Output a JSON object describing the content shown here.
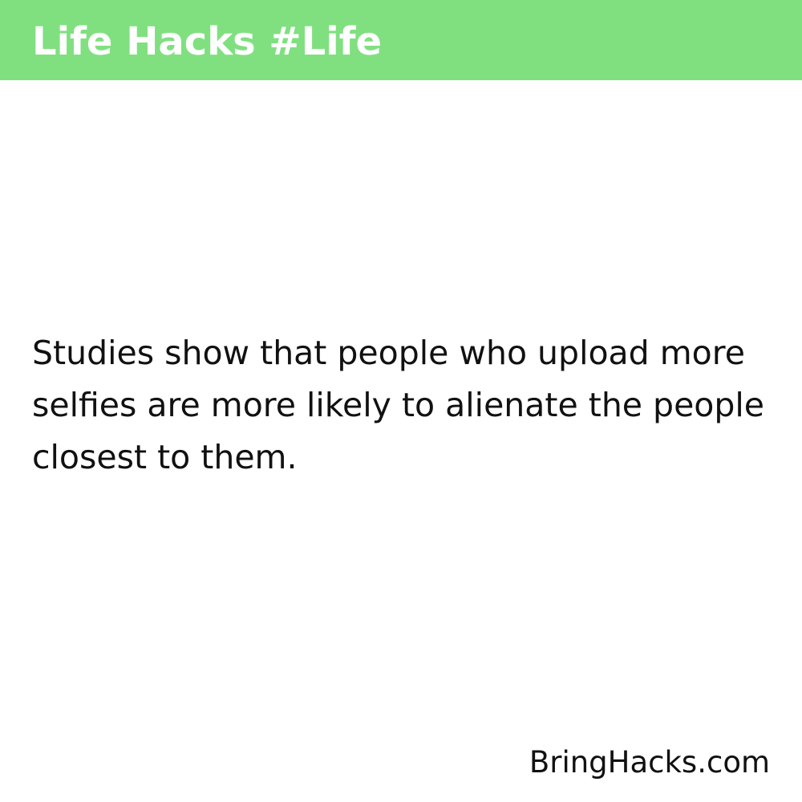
{
  "header": {
    "title": "Life Hacks #Life",
    "background_color": "#80e080",
    "text_color": "#ffffff"
  },
  "content": {
    "text": "Studies show that people who upload more selfies are more likely to alienate the people closest to them."
  },
  "footer": {
    "credit": "BringHacks.com"
  }
}
